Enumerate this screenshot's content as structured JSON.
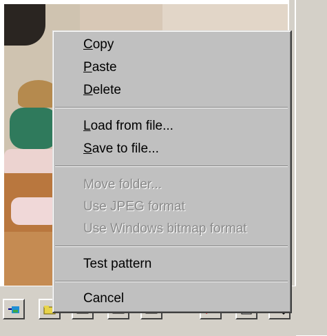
{
  "menu": {
    "items": [
      {
        "pre": "",
        "u": "C",
        "post": "opy",
        "enabled": true
      },
      {
        "pre": "",
        "u": "P",
        "post": "aste",
        "enabled": true
      },
      {
        "pre": "",
        "u": "D",
        "post": "elete",
        "enabled": true
      },
      {
        "pre": "",
        "u": "L",
        "post": "oad from file...",
        "enabled": true
      },
      {
        "pre": "",
        "u": "S",
        "post": "ave to file...",
        "enabled": true
      },
      {
        "pre": "",
        "u": "",
        "post": "Move folder...",
        "enabled": false
      },
      {
        "pre": "",
        "u": "",
        "post": "Use JPEG format",
        "enabled": false
      },
      {
        "pre": "",
        "u": "",
        "post": "Use Windows bitmap format",
        "enabled": false
      },
      {
        "pre": "",
        "u": "",
        "post": "Test pattern",
        "enabled": true
      },
      {
        "pre": "",
        "u": "",
        "post": "Cancel",
        "enabled": true
      }
    ]
  },
  "toolbar": {
    "buttons": [
      {
        "icon": "camera-import-icon"
      },
      {
        "icon": "folder-icon"
      },
      {
        "icon": "window-icon"
      },
      {
        "icon": "color-image-icon"
      },
      {
        "icon": "color-image-icon"
      },
      {
        "icon": "palette-icon"
      },
      {
        "icon": "clipboard-icon"
      },
      {
        "icon": "magnifier-icon"
      }
    ]
  },
  "colors": {
    "menu_bg": "#c0c0c0",
    "disabled_text": "#8a8a8a",
    "toolbar_bg": "#d4d0c8"
  }
}
